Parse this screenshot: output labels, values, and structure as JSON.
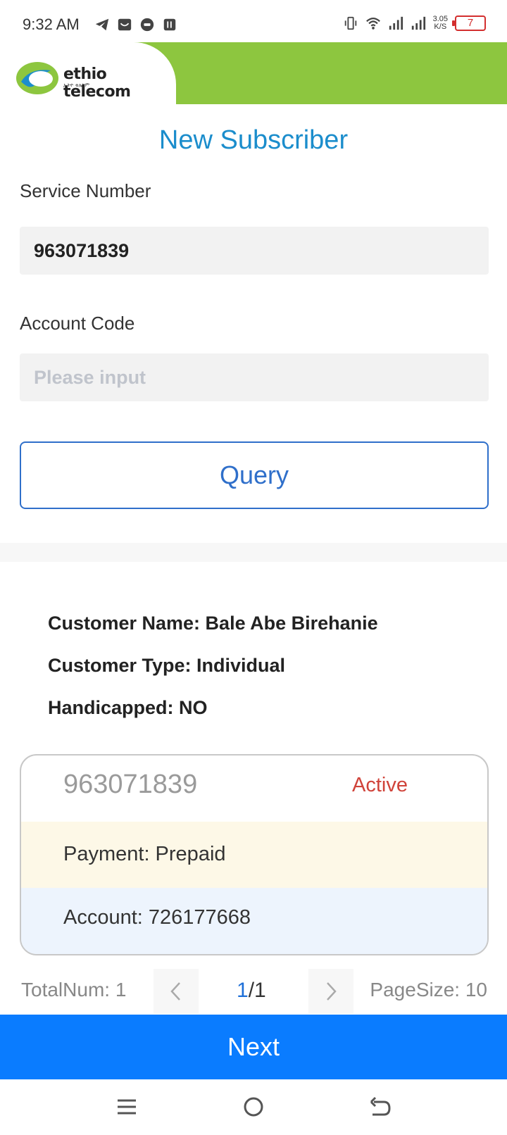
{
  "status_bar": {
    "time": "9:32 AM",
    "network_speed_value": "3.05",
    "network_speed_unit": "K/S",
    "battery_level": "7",
    "icons": [
      "telegram-icon",
      "inbox-icon",
      "alert-icon",
      "nfc-icon",
      "vibrate-icon",
      "wifi-icon",
      "signal-icon",
      "signal-icon",
      "battery-icon"
    ]
  },
  "header": {
    "brand_name": "ethio telecom",
    "brand_subtitle": "ኢትዮ ቴሌኮም",
    "brand_color": "#8dc63f"
  },
  "page": {
    "title": "New Subscriber"
  },
  "form": {
    "service_number_label": "Service Number",
    "service_number_value": "963071839",
    "account_code_label": "Account Code",
    "account_code_placeholder": "Please input",
    "query_label": "Query"
  },
  "customer": {
    "name_line": "Customer Name: Bale Abe Birehanie",
    "type_line": "Customer Type: Individual",
    "handicapped_line": "Handicapped: NO"
  },
  "subscriber_card": {
    "number": "963071839",
    "status": "Active",
    "status_color": "#d0433a",
    "payment": "Payment: Prepaid",
    "account": "Account: 726177668"
  },
  "pagination": {
    "total": "TotalNum: 1",
    "current_page": "1",
    "page_separator": "/1",
    "page_size": "PageSize: 10",
    "prev_icon": "chevron-left-icon",
    "next_icon": "chevron-right-icon"
  },
  "actions": {
    "next_label": "Next",
    "accent": "#0a7cff"
  },
  "nav": {
    "icons": [
      "menu-icon",
      "home-icon",
      "back-icon"
    ]
  }
}
